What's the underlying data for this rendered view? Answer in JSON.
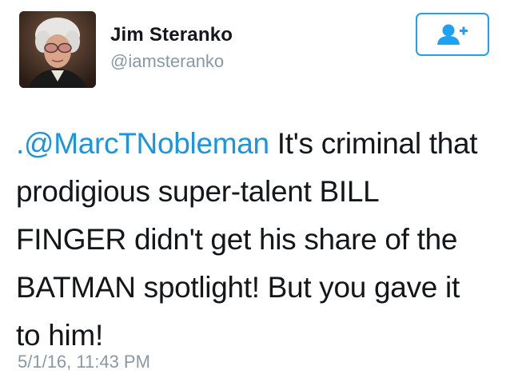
{
  "user": {
    "display_name": "Jim Steranko",
    "handle": "@iamsteranko",
    "avatar_icon": "profile-photo"
  },
  "follow_button": {
    "icon": "follow-user-plus-icon",
    "accent_color": "#1da1f2"
  },
  "tweet": {
    "mention": ".@MarcTNobleman",
    "text_line_1_rest": " It's criminal that",
    "text_line_2": "prodigious super-talent BILL",
    "text_line_3": "FINGER didn't get his share of the",
    "text_line_4": "BATMAN spotlight! But you gave it",
    "text_line_5": "to him!",
    "timestamp": "5/1/16, 11:43 PM"
  }
}
